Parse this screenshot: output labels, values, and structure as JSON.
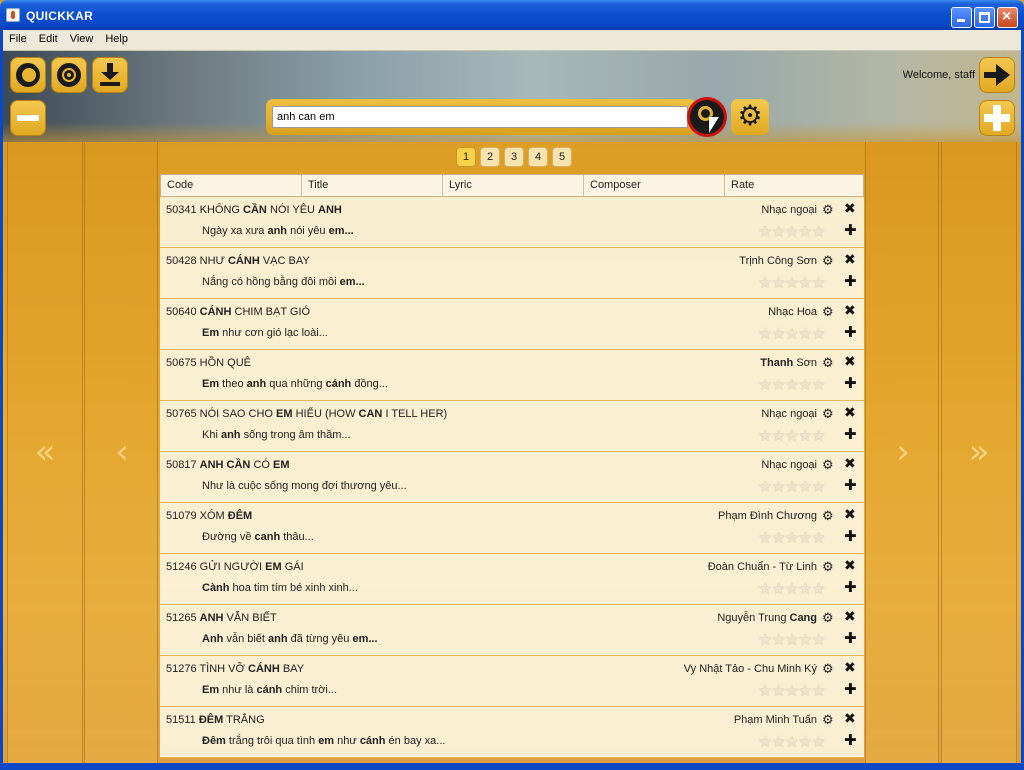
{
  "window": {
    "title": "QUICKKAR"
  },
  "menu": [
    "File",
    "Edit",
    "View",
    "Help"
  ],
  "header": {
    "welcome": "Welcome, staff"
  },
  "search": {
    "value": "anh can em"
  },
  "pagination": {
    "pages": [
      "1",
      "2",
      "3",
      "4",
      "5"
    ],
    "active": "1"
  },
  "nav": {
    "first": "«",
    "prev": "‹",
    "next": "›",
    "last": "»"
  },
  "columns": [
    "Code",
    "Title",
    "Lyric",
    "Composer",
    "Rate"
  ],
  "rows": [
    {
      "title_html": "50341 KHÔNG <b>CẦN</b> NÓI YÊU <b>ANH</b>",
      "lyric_html": "Ngày xa xưa <b>anh</b> nói yêu <b>em...</b>",
      "composer_html": "Nhạc ngoại",
      "rating": 0
    },
    {
      "title_html": "50428 NHƯ <b>CÁNH</b> VẠC BAY",
      "lyric_html": "Nắng có hồng bằng đôi môi <b>em...</b>",
      "composer_html": "Trịnh Công Sơn",
      "rating": 0
    },
    {
      "title_html": "50640 <b>CÁNH</b> CHIM BẠT GIÓ",
      "lyric_html": "<b>Em</b> như cơn gió lạc loài...",
      "composer_html": "Nhạc Hoa",
      "rating": 0
    },
    {
      "title_html": "50675 HỒN QUÊ",
      "lyric_html": "<b>Em</b> theo <b>anh</b> qua những <b>cánh</b> đồng...",
      "composer_html": "<b>Thanh</b> Sơn",
      "rating": 0
    },
    {
      "title_html": "50765 NÓI SAO CHO <b>EM</b> HIỂU (HOW <b>CAN</b> I TELL HER)",
      "lyric_html": "Khi <b>anh</b> sống trong âm thầm...",
      "composer_html": "Nhạc ngoại",
      "rating": 0
    },
    {
      "title_html": "50817 <b>ANH CẦN</b> CÓ <b>EM</b>",
      "lyric_html": "Như là cuộc sống mong đợi thương yêu...",
      "composer_html": "Nhạc ngoại",
      "rating": 0
    },
    {
      "title_html": "51079 XÓM <b>ĐÊM</b>",
      "lyric_html": "Đường về <b>canh</b> thâu...",
      "composer_html": "Phạm Đình Chương",
      "rating": 0
    },
    {
      "title_html": "51246 GỬI NGƯỜI <b>EM</b> GÁI",
      "lyric_html": "<b>Cành</b> hoa tim tím bé xinh xinh...",
      "composer_html": "Đoàn Chuẩn - Từ Linh",
      "rating": 0
    },
    {
      "title_html": "51265 <b>ANH</b> VẪN BIẾT",
      "lyric_html": "<b>Anh</b> vẫn biết <b>anh</b> đã từng yêu <b>em...</b>",
      "composer_html": "Nguyễn Trung <b>Cang</b>",
      "rating": 0
    },
    {
      "title_html": "51276 TÌNH VỠ <b>CÁNH</b> BAY",
      "lyric_html": "<b>Em</b> như là <b>cánh</b> chim trời...",
      "composer_html": "Vy Nhật Tảo - Chu Minh Ký",
      "rating": 0
    },
    {
      "title_html": "51511 <b>ĐÊM</b> TRẮNG",
      "lyric_html": "<b>Đêm</b> trắng trôi qua tình <b>em</b> như <b>cánh</b> én bay xa...",
      "composer_html": "Phạm Minh Tuấn",
      "rating": 0
    }
  ],
  "icons": {
    "row_settings": "gear-icon",
    "row_delete": "close-icon",
    "row_add": "plus-icon",
    "rating": "star-icon"
  },
  "colors": {
    "titlebar": "#0a4ed0",
    "gold": "#e6aa2c",
    "search_button_ring": "#cc1010"
  }
}
